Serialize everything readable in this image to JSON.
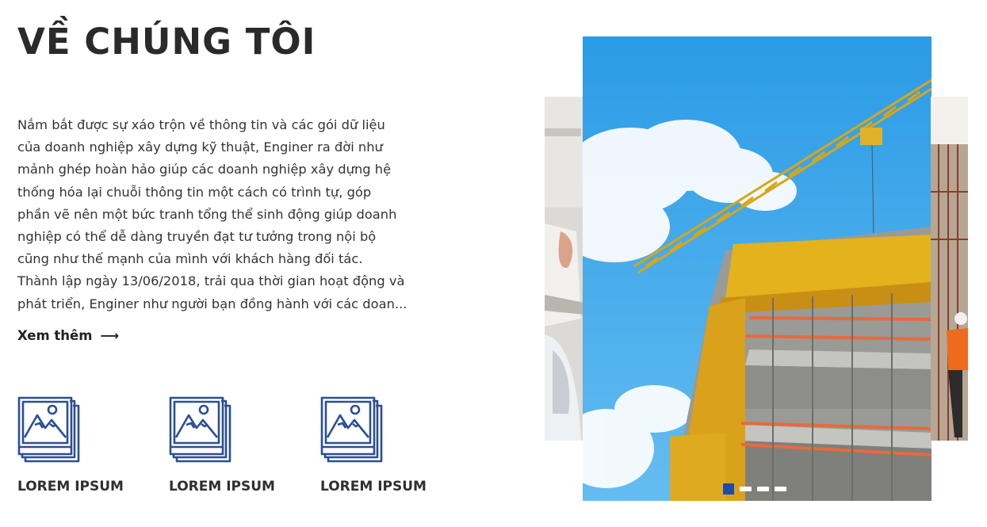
{
  "about": {
    "title": "VỀ CHÚNG TÔI",
    "description_lines": [
      "Nắm bắt được sự xáo trộn về thông tin và các gói dữ liệu",
      "của doanh nghiệp xây dựng kỹ thuật, Enginer ra đời như",
      "mảnh ghép hoàn hảo giúp các doanh nghiệp xây dựng hệ",
      "thống hóa lại chuỗi thông tin một cách có trình tự, góp",
      "phần vẽ nên một bức tranh tổng thể sinh động giúp doanh",
      "nghiệp có thể dễ dàng truyền đạt tư tưởng trong nội bộ",
      "cũng như thế mạnh của mình với khách hàng đối tác.",
      "Thành lập ngày 13/06/2018, trải qua thời gian hoạt động và",
      "phát triển, Enginer như người bạn đồng hành với các doan..."
    ],
    "read_more_label": "Xem thêm",
    "read_more_arrow": "⟶"
  },
  "features": [
    {
      "label": "LOREM IPSUM",
      "icon": "image-gallery-icon"
    },
    {
      "label": "LOREM IPSUM",
      "icon": "image-gallery-icon"
    },
    {
      "label": "LOREM IPSUM",
      "icon": "image-gallery-icon"
    }
  ],
  "carousel": {
    "slide_count": 4,
    "active_index": 0,
    "image": "construction-crane-building-photo"
  },
  "colors": {
    "accent": "#1f4aa8",
    "icon": "#2a4f94",
    "title": "#2a2a2a",
    "text": "#333333"
  }
}
